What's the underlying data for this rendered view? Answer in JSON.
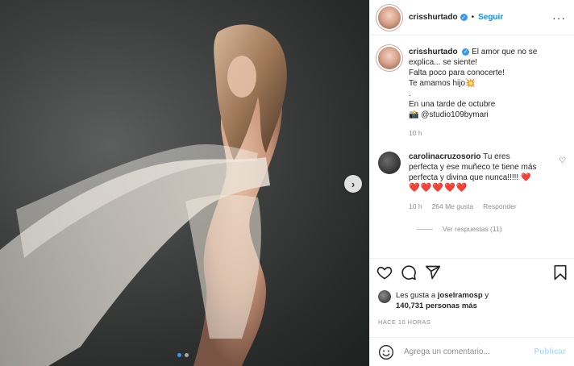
{
  "post": {
    "username": "crisshurtado",
    "follow_label": "Seguir",
    "separator": "•",
    "more_label": "···"
  },
  "caption": {
    "username": "crisshurtado",
    "lines": [
      "El amor que no se",
      "explica... se siente!",
      "Falta poco para conocerte!",
      "Te amamos hijo💥",
      ".",
      "En una tarde de octubre",
      "📸 @studio109bymari"
    ],
    "time": "10 h"
  },
  "comment": {
    "username": "carolinacruzosorio",
    "lines": [
      "Tu eres",
      "perfecta y ese muñeco te tiene más",
      "perfecta y divina que nunca!!!!! ❤️"
    ],
    "hearts": "❤️❤️❤️❤️❤️",
    "time": "10 h",
    "likes": "264 Me gusta",
    "reply_label": "Responder",
    "view_replies": "Ver respuestas (11)"
  },
  "likes": {
    "prefix": "Les gusta a",
    "user": "joselramosp",
    "connector": "y",
    "count": "140,731 personas más"
  },
  "posted_ago": "HACE 10 HORAS",
  "composer": {
    "placeholder": "Agrega un comentario...",
    "publish_label": "Publicar"
  },
  "carousel": {
    "total": 2,
    "current": 1
  },
  "colors": {
    "accent": "#0095f6",
    "verified": "#3897f0",
    "heart": "#ed1c24",
    "muted": "#8e8e8e"
  },
  "icons": [
    "verified-icon",
    "more-icon",
    "heart-icon",
    "comment-icon",
    "share-icon",
    "bookmark-icon",
    "emoji-icon",
    "chevron-right-icon"
  ]
}
